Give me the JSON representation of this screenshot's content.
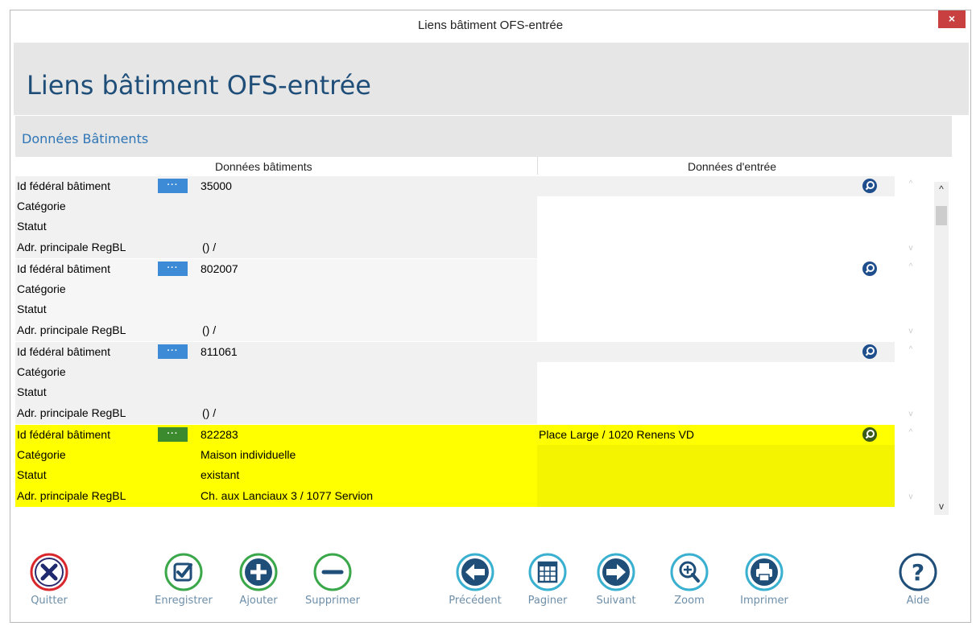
{
  "window": {
    "title": "Liens bâtiment OFS-entrée",
    "close_glyph": "×"
  },
  "header": {
    "title": "Liens bâtiment OFS-entrée"
  },
  "section": {
    "title": "Données Bâtiments"
  },
  "columns": {
    "left": "Données bâtiments",
    "right": "Données d'entrée"
  },
  "labels": {
    "id": "Id fédéral bâtiment",
    "category": "Catégorie",
    "status": "Statut",
    "address": "Adr. principale RegBL",
    "dots": "···"
  },
  "records": [
    {
      "id": "35000",
      "category": "",
      "status": "",
      "address": "() /",
      "entry": ""
    },
    {
      "id": "802007",
      "category": "",
      "status": "",
      "address": "() /",
      "entry": ""
    },
    {
      "id": "811061",
      "category": "",
      "status": "",
      "address": "() /",
      "entry": ""
    },
    {
      "id": "822283",
      "category": "Maison individuelle",
      "status": "existant",
      "address": "Ch. aux Lanciaux 3 / 1077 Servion",
      "entry": "Place Large / 1020 Renens VD"
    }
  ],
  "toolbar": {
    "quit": "Quitter",
    "save": "Enregistrer",
    "add": "Ajouter",
    "delete": "Supprimer",
    "previous": "Précédent",
    "paginate": "Paginer",
    "next": "Suivant",
    "zoom": "Zoom",
    "print": "Imprimer",
    "help": "Aide"
  },
  "colors": {
    "title_blue": "#1f4e79",
    "highlight": "#ffff00",
    "quit_red": "#d9272e",
    "green": "#3aa84a",
    "blue": "#1f6fb5"
  }
}
